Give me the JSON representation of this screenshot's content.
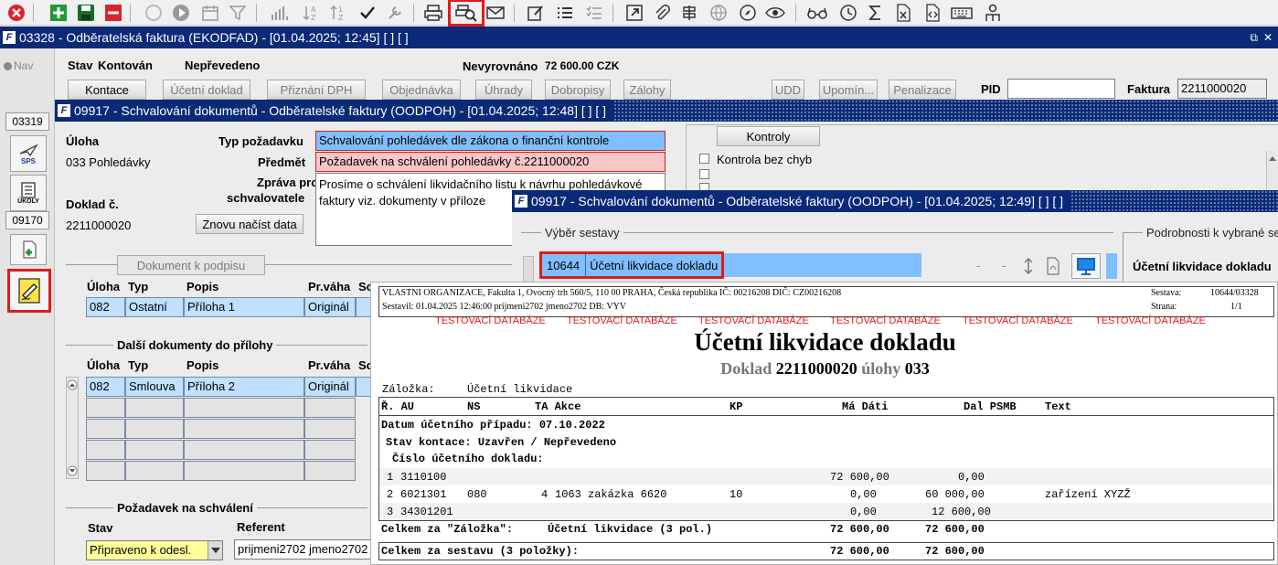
{
  "toolbar": {
    "icons": [
      "cancel-icon",
      "add-icon",
      "save-icon",
      "delete-icon",
      "circle-icon",
      "play-icon",
      "calendar-icon",
      "filter-icon",
      "chart-icon",
      "sort-az-icon",
      "sort-za-icon",
      "check-icon",
      "wrench-icon",
      "print-icon",
      "print-preview-icon",
      "mail-icon",
      "edit-icon",
      "list-icon",
      "checklist-icon",
      "open-external-icon",
      "attach-icon",
      "signpost-icon",
      "globe-icon",
      "compass-icon",
      "eye-icon",
      "glasses-icon",
      "clock-icon",
      "sigma-icon",
      "excel-icon",
      "html-icon",
      "keyboard-icon",
      "person-icon"
    ]
  },
  "main_window": {
    "title": "03328 - Odběratelská faktura (EKODFAD) - [01.04.2025; 12:45]  [ ]  [ ]",
    "restore_glyph": "⧉",
    "close_glyph": "✕"
  },
  "sidebar": {
    "nav_label": "Nav",
    "doc_tab_1": "03319",
    "doc_tab_2": "09170",
    "sps_label": "SPS",
    "ukoly_label": "ÚKOLY"
  },
  "status": {
    "stav_label": "Stav",
    "stav_value": "Kontován",
    "prevedeno": "Nepřevedeno",
    "nevyrovnano_label": "Nevyrovnáno",
    "nevyrovnano_value": "72 600.00 CZK"
  },
  "tabs": {
    "kontace": "Kontace",
    "ucetni_doklad": "Účetní doklad",
    "priznani_dph": "Přiznání DPH",
    "objednavka": "Objednávka",
    "uhrady": "Úhrady",
    "dobropisy": "Dobropisy",
    "zalohy": "Zálohy",
    "udd": "UDD",
    "upomin": "Upomín...",
    "penalizace": "Penalizace",
    "pid_label": "PID",
    "pid_value": "",
    "faktura_label": "Faktura",
    "faktura_value": "2211000020"
  },
  "approval_window": {
    "title": "09917 - Schvalování dokumentů - Odběratelské faktury (OODPOH) - [01.04.2025; 12:48]  [ ]  [ ]",
    "uloha_label": "Úloha",
    "uloha_value": "033 Pohledávky",
    "doklad_label": "Doklad č.",
    "doklad_value": "2211000020",
    "reload_button": "Znovu načíst data",
    "typ_label": "Typ požadavku",
    "typ_value": "Schvalování pohledávek dle zákona o finanční kontrole",
    "predmet_label": "Předmět",
    "predmet_value": "Požadavek na schválení pohledávky č.2211000020",
    "zprava_label_1": "Zpráva pro",
    "zprava_label_2": "schvalovatele",
    "zprava_value": "Prosíme o schválení likvidačního listu k návrhu pohledávkové faktury viz. dokumenty v příloze",
    "kontroly_button": "Kontroly",
    "kontrola_label": "Kontrola bez chyb",
    "dokument_button": "Dokument k podpisu",
    "cols": [
      "Úloha",
      "Typ",
      "Popis",
      "Pr.váha",
      "So"
    ],
    "doc_row": [
      "082",
      "Ostatní",
      "Příloha 1",
      "Originál"
    ],
    "dalsi_heading": "Další dokumenty do přílohy",
    "dalsi_row": [
      "082",
      "Smlouva",
      "Příloha 2",
      "Originál"
    ],
    "pozadavek_heading": "Požadavek na schválení",
    "stav_col": "Stav",
    "referent_col": "Referent",
    "stav_value": "Připraveno k odesl.",
    "referent_value": "prijmeni2702 jmeno2702"
  },
  "print_window": {
    "title": "09917 - Schvalování dokumentů - Odběratelské faktury (OODPOH) - [01.04.2025; 12:49]  [ ]  [ ]",
    "vyber_heading": "Výběr sestavy",
    "podrobnosti_heading": "Podrobnosti k vybrané sestavě",
    "report_code": "10644",
    "report_name": "Účetní likvidace dokladu",
    "dash_1": "-",
    "dash_2": "-",
    "detail_title": "Účetní likvidace dokladu"
  },
  "report": {
    "org_line": "VLASTNI ORGANIZACE, Fakulta 1, Ovocný trh 560/5, 110 00 PRAHA, Česká republika  IČ: 00216208  DIČ: CZ00216208",
    "sestavil_line": "Sestavil: 01.04.2025 12:46:00 prijmeni2702 jmeno2702  DB: VYV",
    "sestava_label": "Sestava:",
    "sestava_value": "10644/03328",
    "strana_label": "Strana:",
    "strana_value": "1/1",
    "test_db": "TESTOVACÍ DATABÁZE",
    "title": "Účetní likvidace dokladu",
    "subtitle_doklad": "Doklad",
    "subtitle_number": "2211000020",
    "subtitle_ulohy": "úlohy",
    "subtitle_uloha_no": "033",
    "zalozka_label": "Záložka:",
    "zalozka_value": "Účetní likvidace",
    "headers": [
      "Ř. AU",
      "NS",
      "TA Akce",
      "KP",
      "Má Dáti",
      "Dal PSMB",
      "Text"
    ],
    "datum": "Datum účetního případu: 07.10.2022",
    "stav_kontace": "Stav kontace: Uzavřen / Nepřevedeno",
    "cislo_ucet": "Číslo účetního dokladu:",
    "rows": [
      {
        "r": "1",
        "au": "3110100",
        "ns": "",
        "ta": "",
        "akce": "",
        "kp": "",
        "ma": "72 600,00",
        "dal": "0,00",
        "text": ""
      },
      {
        "r": "2",
        "au": "6021301",
        "ns": "080",
        "ta": "4",
        "akce": "1063 zakázka 6620",
        "kp": "10",
        "ma": "0,00",
        "dal": "60 000,00",
        "text": "zařízení XYZŽ"
      },
      {
        "r": "3",
        "au": "34301201",
        "ns": "",
        "ta": "",
        "akce": "",
        "kp": "",
        "ma": "0,00",
        "dal": "12 600,00",
        "text": ""
      }
    ],
    "celkem_zalozka_label": "Celkem za \"Záložka\":",
    "celkem_zalozka_name": "Účetní likvidace (3 pol.)",
    "celkem_zalozka_ma": "72 600,00",
    "celkem_zalozka_dal": "72 600,00",
    "celkem_sestava_label": "Celkem za sestavu (3 položky):",
    "celkem_sestava_ma": "72 600,00",
    "celkem_sestava_dal": "72 600,00"
  }
}
